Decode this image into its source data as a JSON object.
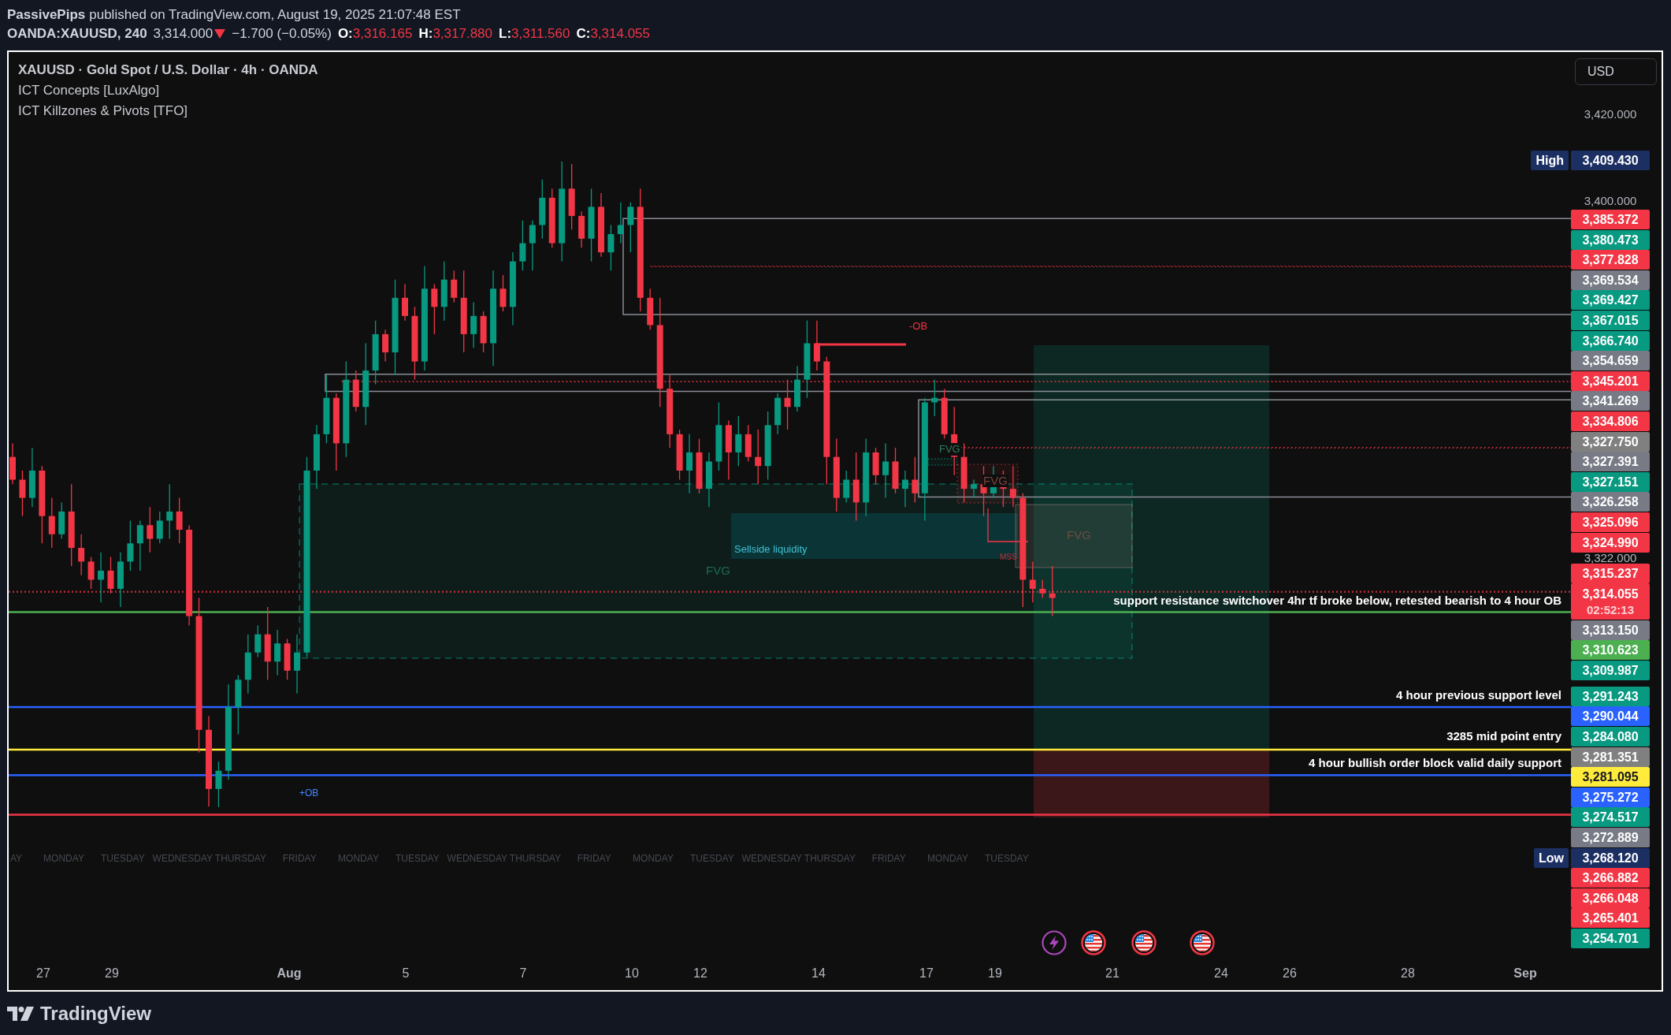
{
  "header": {
    "author": "PassivePips",
    "info": "published on TradingView.com, August 19, 2025 21:07:48 EST"
  },
  "quote": {
    "symbol": "OANDA:XAUUSD, 240",
    "last": "3,314.000",
    "falling": true,
    "change": "−1.700 (−0.05%)",
    "ohlc": [
      {
        "label": "O:",
        "value": "3,316.165"
      },
      {
        "label": "H:",
        "value": "3,317.880"
      },
      {
        "label": "L:",
        "value": "3,311.560"
      },
      {
        "label": "C:",
        "value": "3,314.055"
      }
    ]
  },
  "legend": {
    "title": "XAUUSD · Gold Spot / U.S. Dollar · 4h · OANDA",
    "indicators": [
      "ICT Concepts [LuxAlgo]",
      "ICT Killzones & Pivots [TFO]"
    ]
  },
  "currency": "USD",
  "chart_labels": [
    {
      "kind": "bearish_ob",
      "text": "-OB"
    },
    {
      "kind": "liquidity",
      "text": "Sellside liquidity"
    },
    {
      "kind": "bullish_fvg",
      "text": "FVG"
    },
    {
      "kind": "bullish_fvg_small",
      "text": "FVG"
    },
    {
      "kind": "bearish_fvg_small",
      "text": "FVG"
    },
    {
      "kind": "bearish_fvg",
      "text": "FVG"
    },
    {
      "kind": "mss",
      "text": "MSS"
    },
    {
      "kind": "bullish_ob",
      "text": "+OB"
    }
  ],
  "levels": [
    {
      "label": "support resistance switchover 4hr tf broke below, retested bearish to 4 hour OB",
      "color": "#4caf50"
    },
    {
      "label": "4 hour previous support level",
      "color": "#2962ff"
    },
    {
      "label": "3285 mid point entry",
      "color": "#ffeb3b"
    },
    {
      "label": "4 hour bullish order block valid daily support",
      "color": "#2962ff"
    }
  ],
  "weekday_labels": [
    "AY",
    "MONDAY",
    "TUESDAY",
    "WEDNESDAY",
    "THURSDAY",
    "FRIDAY",
    "MONDAY",
    "TUESDAY",
    "WEDNESDAY",
    "THURSDAY",
    "FRIDAY",
    "MONDAY",
    "TUESDAY",
    "WEDNESDAY",
    "THURSDAY",
    "FRIDAY",
    "MONDAY",
    "TUESDAY"
  ],
  "price_axis": [
    {
      "kind": "tick",
      "text": "3,420.000"
    },
    {
      "kind": "extreme",
      "tag": "High",
      "text": "3,409.430"
    },
    {
      "kind": "tick",
      "text": "3,400.000"
    },
    {
      "kind": "label",
      "text": "3,385.372",
      "color": "#f23645"
    },
    {
      "kind": "label",
      "text": "3,380.473",
      "color": "#089981"
    },
    {
      "kind": "label",
      "text": "3,377.828",
      "color": "#f23645"
    },
    {
      "kind": "label",
      "text": "3,369.534",
      "color": "#787b86"
    },
    {
      "kind": "label",
      "text": "3,369.427",
      "color": "#089981"
    },
    {
      "kind": "label",
      "text": "3,367.015",
      "color": "#089981"
    },
    {
      "kind": "label",
      "text": "3,366.740",
      "color": "#089981"
    },
    {
      "kind": "label",
      "text": "3,354.659",
      "color": "#787b86"
    },
    {
      "kind": "label",
      "text": "3,345.201",
      "color": "#f23645"
    },
    {
      "kind": "label",
      "text": "3,341.269",
      "color": "#787b86"
    },
    {
      "kind": "label",
      "text": "3,334.806",
      "color": "#f23645"
    },
    {
      "kind": "label",
      "text": "3,327.750",
      "color": "#808080"
    },
    {
      "kind": "label",
      "text": "3,327.391",
      "color": "#787b86"
    },
    {
      "kind": "label",
      "text": "3,327.151",
      "color": "#089981"
    },
    {
      "kind": "label",
      "text": "3,326.258",
      "color": "#787b86"
    },
    {
      "kind": "label",
      "text": "3,325.096",
      "color": "#f23645"
    },
    {
      "kind": "label",
      "text": "3,324.990",
      "color": "#f23645"
    },
    {
      "kind": "tick",
      "text": "3,322.000"
    },
    {
      "kind": "label",
      "text": "3,315.237",
      "color": "#f23645"
    },
    {
      "kind": "label",
      "text": "3,314.055",
      "countdown": "02:52:13",
      "color": "#f23645"
    },
    {
      "kind": "label",
      "text": "3,313.150",
      "color": "#787b86"
    },
    {
      "kind": "label",
      "text": "3,310.623",
      "color": "#4caf50"
    },
    {
      "kind": "label",
      "text": "3,309.987",
      "color": "#089981"
    },
    {
      "kind": "label",
      "text": "3,291.243",
      "color": "#089981"
    },
    {
      "kind": "label",
      "text": "3,290.044",
      "color": "#2962ff"
    },
    {
      "kind": "label",
      "text": "3,284.080",
      "color": "#089981"
    },
    {
      "kind": "label",
      "text": "3,281.351",
      "color": "#808080"
    },
    {
      "kind": "label",
      "text": "3,281.095",
      "color": "#ffeb3b"
    },
    {
      "kind": "label",
      "text": "3,275.272",
      "color": "#2962ff"
    },
    {
      "kind": "label",
      "text": "3,274.517",
      "color": "#089981"
    },
    {
      "kind": "label",
      "text": "3,272.889",
      "color": "#787b86"
    },
    {
      "kind": "extreme",
      "tag": "Low",
      "text": "3,268.120"
    },
    {
      "kind": "label",
      "text": "3,266.882",
      "color": "#f23645"
    },
    {
      "kind": "label",
      "text": "3,266.048",
      "color": "#f23645"
    },
    {
      "kind": "label",
      "text": "3,265.401",
      "color": "#f23645"
    },
    {
      "kind": "label",
      "text": "3,254.701",
      "color": "#089981"
    }
  ],
  "dates": [
    {
      "kind": "day",
      "text": "27"
    },
    {
      "kind": "day",
      "text": "29"
    },
    {
      "kind": "month",
      "text": "Aug"
    },
    {
      "kind": "day",
      "text": "5"
    },
    {
      "kind": "day",
      "text": "7"
    },
    {
      "kind": "day",
      "text": "10"
    },
    {
      "kind": "day",
      "text": "12"
    },
    {
      "kind": "day",
      "text": "14"
    },
    {
      "kind": "day",
      "text": "17"
    },
    {
      "kind": "day",
      "text": "19"
    },
    {
      "kind": "day",
      "text": "21"
    },
    {
      "kind": "day",
      "text": "24"
    },
    {
      "kind": "day",
      "text": "26"
    },
    {
      "kind": "day",
      "text": "28"
    },
    {
      "kind": "month",
      "text": "Sep"
    }
  ],
  "footer": {
    "brand": "TradingView"
  }
}
